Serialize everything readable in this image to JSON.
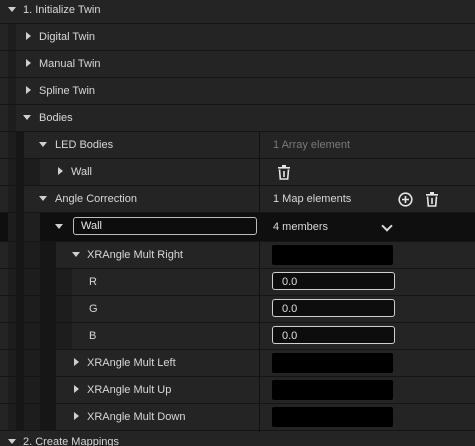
{
  "section1": {
    "title": "1. Initialize Twin"
  },
  "items": {
    "digital_twin": "Digital Twin",
    "manual_twin": "Manual Twin",
    "spline_twin": "Spline Twin",
    "bodies": "Bodies",
    "led_bodies": "LED Bodies",
    "led_bodies_value": "1 Array element",
    "wall_element": "Wall",
    "angle_correction": "Angle Correction",
    "angle_correction_value": "1 Map elements",
    "map_key": "Wall",
    "map_value": "4 members",
    "xr_right": "XRAngle Mult Right",
    "r_label": "R",
    "r_value": "0.0",
    "g_label": "G",
    "g_value": "0.0",
    "b_label": "B",
    "b_value": "0.0",
    "xr_left": "XRAngle Mult Left",
    "xr_up": "XRAngle Mult Up",
    "xr_down": "XRAngle Mult Down"
  },
  "section2": {
    "title": "2. Create Mappings"
  },
  "icons": {
    "delete": "trash-icon",
    "add": "plus-circle-icon",
    "dropdown": "chevron-down-icon"
  },
  "colors": {
    "background": "#151515",
    "row": "#242424",
    "color_swatch": "#000000"
  }
}
